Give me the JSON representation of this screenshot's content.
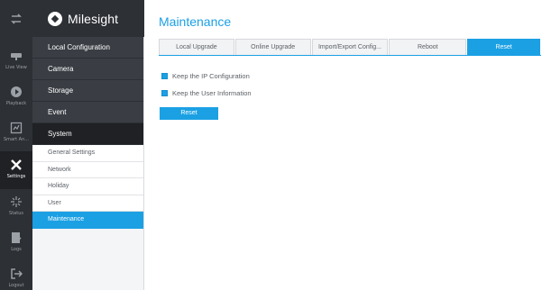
{
  "app": {
    "brand": "Milesight"
  },
  "rail": [
    {
      "label": "",
      "icon": "transfer-icon"
    },
    {
      "label": "Live View",
      "icon": "camera-icon"
    },
    {
      "label": "Playback",
      "icon": "playback-icon"
    },
    {
      "label": "Smart An...",
      "icon": "analytics-icon"
    },
    {
      "label": "Settings",
      "icon": "tools-icon"
    },
    {
      "label": "Status",
      "icon": "status-icon"
    },
    {
      "label": "Logs",
      "icon": "logs-icon"
    },
    {
      "label": "Logout",
      "icon": "logout-icon"
    }
  ],
  "menu": {
    "main": [
      "Local Configuration",
      "Camera",
      "Storage",
      "Event",
      "System"
    ],
    "system_sub": [
      "General Settings",
      "Network",
      "Holiday",
      "User",
      "Maintenance"
    ]
  },
  "main": {
    "title": "Maintenance",
    "tabs": [
      "Local Upgrade",
      "Online Upgrade",
      "Import/Export Config...",
      "Reboot",
      "Reset"
    ],
    "options": [
      "Keep the IP Configuration",
      "Keep the User Information"
    ],
    "reset_button": "Reset"
  },
  "colors": {
    "accent": "#1ba0e4",
    "rail_bg": "#2d3035"
  }
}
